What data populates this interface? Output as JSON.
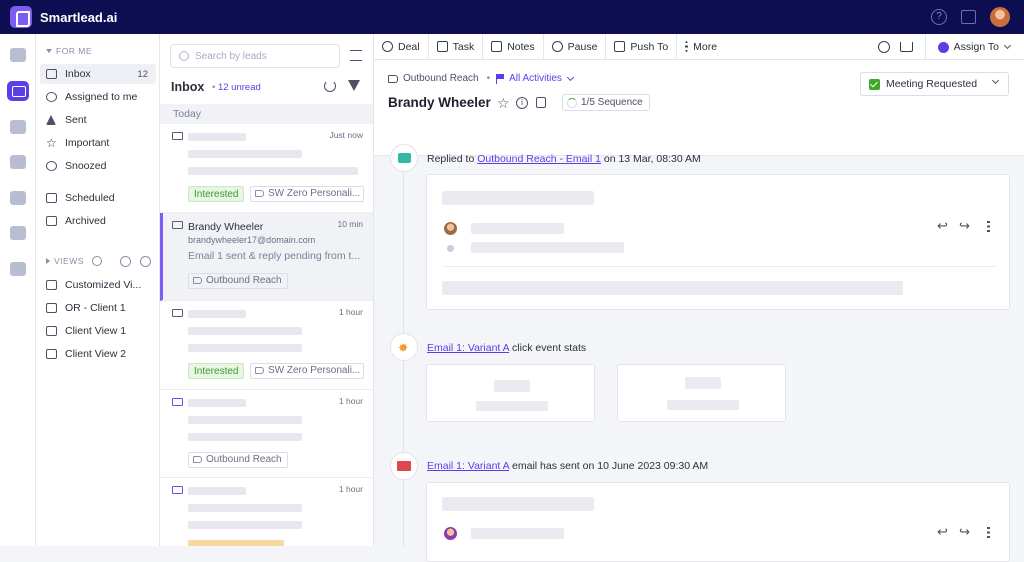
{
  "app": {
    "name": "Smartlead.ai"
  },
  "sidebar": {
    "for_me_heading": "FOR ME",
    "items": [
      {
        "label": "Inbox",
        "count": "12"
      },
      {
        "label": "Assigned to me"
      },
      {
        "label": "Sent"
      },
      {
        "label": "Important"
      },
      {
        "label": "Snoozed"
      },
      {
        "label": "Scheduled"
      },
      {
        "label": "Archived"
      }
    ],
    "views_heading": "VIEWS",
    "views": [
      "Customized Vi...",
      "OR - Client 1",
      "Client View 1",
      "Client View 2"
    ]
  },
  "list": {
    "search_placeholder": "Search by leads",
    "title": "Inbox",
    "unread": "12 unread",
    "group": "Today",
    "cards": [
      {
        "time": "Just now",
        "tags": [
          "Interested",
          "SW Zero Personali..."
        ]
      },
      {
        "name": "Brandy Wheeler",
        "email": "brandywheeler17@domain.com",
        "time": "10 min",
        "snippet": "Email 1 sent & reply pending from t...",
        "tags": [
          "Outbound Reach"
        ]
      },
      {
        "time": "1 hour",
        "tags": [
          "Interested",
          "SW Zero Personali..."
        ]
      },
      {
        "time": "1 hour",
        "tags": [
          "Outbound Reach"
        ]
      },
      {
        "time": "1 hour"
      }
    ]
  },
  "toolbar": {
    "deal": "Deal",
    "task": "Task",
    "notes": "Notes",
    "pause": "Pause",
    "push_to": "Push To",
    "more": "More",
    "assign_to": "Assign To"
  },
  "lead": {
    "campaign": "Outbound Reach",
    "activities": "All Activities",
    "name": "Brandy Wheeler",
    "sequence": "1/5 Sequence",
    "status": "Meeting Requested"
  },
  "timeline": {
    "e1": {
      "prefix": "Replied to ",
      "link": "Outbound Reach - Email 1",
      "suffix": " on 13 Mar, 08:30 AM"
    },
    "e2": {
      "link": "Email 1: Variant A",
      "suffix": " click event stats"
    },
    "e3": {
      "link": "Email 1: Variant A",
      "suffix": " email has sent on 10 June 2023 09:30 AM"
    }
  },
  "colors": {
    "topbar": "#0d0e52",
    "accent": "#5b3ee8",
    "interested": "#3e9a31",
    "status_check": "#3ea82c"
  }
}
